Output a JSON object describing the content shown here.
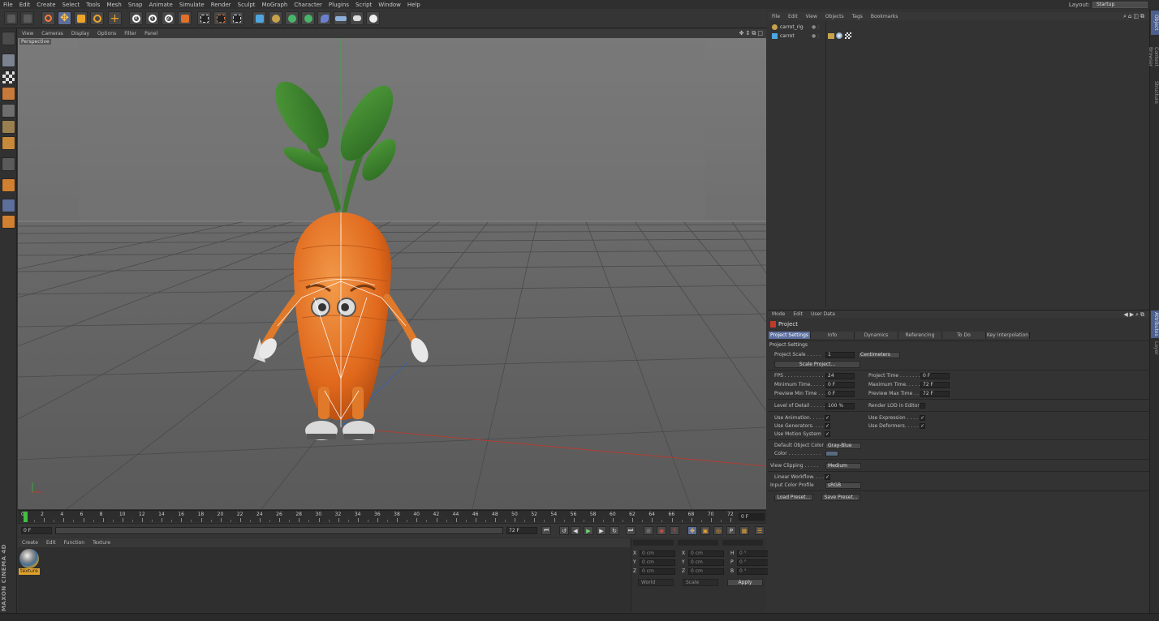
{
  "menu": [
    "File",
    "Edit",
    "Create",
    "Select",
    "Tools",
    "Mesh",
    "Snap",
    "Animate",
    "Simulate",
    "Render",
    "Sculpt",
    "MoGraph",
    "Character",
    "Plugins",
    "Script",
    "Window",
    "Help"
  ],
  "layout": {
    "label": "Layout:",
    "value": "Startup"
  },
  "viewport": {
    "menu": [
      "View",
      "Cameras",
      "Display",
      "Options",
      "Filter",
      "Panel"
    ],
    "label": "Perspective",
    "icons": "✥↕⧉□"
  },
  "timeline": {
    "ticks": [
      "0",
      "2",
      "4",
      "6",
      "8",
      "10",
      "12",
      "14",
      "16",
      "18",
      "20",
      "22",
      "24",
      "26",
      "28",
      "30",
      "32",
      "34",
      "36",
      "38",
      "40",
      "42",
      "44",
      "46",
      "48",
      "50",
      "52",
      "54",
      "56",
      "58",
      "60",
      "62",
      "64",
      "66",
      "68",
      "70",
      "72"
    ],
    "current_frame": "0 F",
    "start": "0 F",
    "end": "72 F",
    "range_end": "72 F"
  },
  "material": {
    "menu": [
      "Create",
      "Edit",
      "Function",
      "Texture"
    ],
    "name": "texture"
  },
  "coords": {
    "rows": [
      {
        "a": "X",
        "av": "0 cm",
        "b": "X",
        "bv": "0 cm",
        "c": "H",
        "cv": "0 °"
      },
      {
        "a": "Y",
        "av": "0 cm",
        "b": "Y",
        "bv": "0 cm",
        "c": "P",
        "cv": "0 °"
      },
      {
        "a": "Z",
        "av": "0 cm",
        "b": "Z",
        "bv": "0 cm",
        "c": "B",
        "cv": "0 °"
      }
    ],
    "world": "World",
    "scale": "Scale",
    "apply": "Apply"
  },
  "objects": {
    "menu": [
      "File",
      "Edit",
      "View",
      "Objects",
      "Tags",
      "Bookmarks"
    ],
    "items": [
      "carrot_rig",
      "carrot"
    ]
  },
  "attributes": {
    "menu": [
      "Mode",
      "Edit",
      "User Data"
    ],
    "title": "Project",
    "tabs": [
      "Project Settings",
      "Info",
      "Dynamics",
      "Referencing",
      "To Do",
      "Key Interpolation"
    ],
    "section": "Project Settings",
    "project_scale": {
      "label": "Project Scale . . . . .",
      "value": "1",
      "unit": "Centimeters"
    },
    "scale_project": "Scale Project...",
    "fps": {
      "label": "FPS . . . . . . . . . . . . .",
      "value": "24"
    },
    "project_time": {
      "label": "Project Time . . . . . . .",
      "value": "0 F"
    },
    "min_time": {
      "label": "Minimum Time. . . . . .",
      "value": "0 F"
    },
    "max_time": {
      "label": "Maximum Time. . . . . .",
      "value": "72 F"
    },
    "prev_min": {
      "label": "Preview Min Time . . .",
      "value": "0 F"
    },
    "prev_max": {
      "label": "Preview Max Time . . .",
      "value": "72 F"
    },
    "lod": {
      "label": "Level of Detail . . . . .",
      "value": "100 %"
    },
    "render_lod": "Render LOD in Editor",
    "use_animation": "Use Animation. . . . . .",
    "use_expression": "Use Expression . . . . .",
    "use_generators": "Use Generators. . . . . .",
    "use_deformers": "Use Deformers. . . . . .",
    "use_motion": "Use Motion System",
    "default_color": {
      "label": "Default Object Color",
      "value": "Gray-Blue"
    },
    "color_label": "Color . . . . . . . . . . .",
    "view_clipping": {
      "label": "View Clipping . . . . .",
      "value": "Medium"
    },
    "linear_workflow": "Linear Workflow. . . .",
    "input_profile": {
      "label": "Input Color Profile",
      "value": "sRGB"
    },
    "load_preset": "Load Preset...",
    "save_preset": "Save Preset...",
    "check": "✓"
  },
  "right_tabs": [
    "Object",
    "Content Browser",
    "Structure"
  ],
  "right_tabs_attr": [
    "Attributes",
    "Layer"
  ],
  "maxon": "MAXON CINEMA 4D"
}
